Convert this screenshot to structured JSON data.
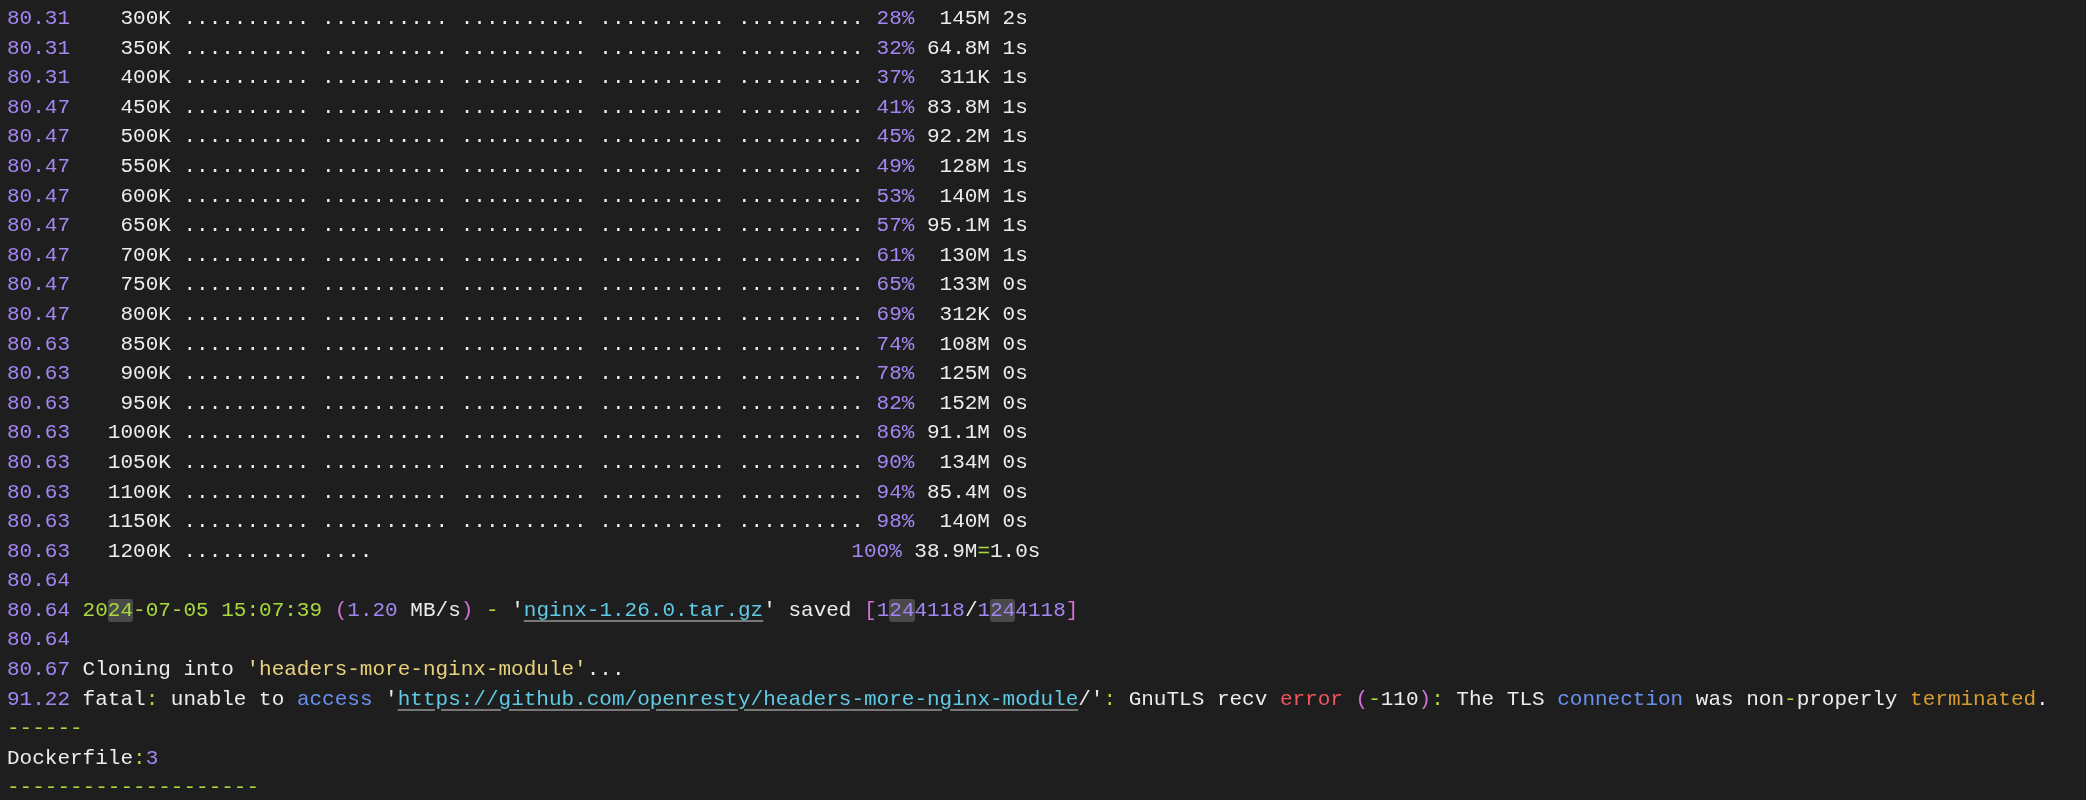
{
  "terminal": {
    "lines": [
      {
        "segments": [
          {
            "text": "80.31",
            "kind": "time"
          },
          {
            "text": "    300K .......... .......... .......... .......... .......... ",
            "kind": "plain"
          },
          {
            "text": "28%",
            "kind": "number"
          },
          {
            "text": "  145M 2s",
            "kind": "plain"
          }
        ]
      },
      {
        "segments": [
          {
            "text": "80.31",
            "kind": "time"
          },
          {
            "text": "    350K .......... .......... .......... .......... .......... ",
            "kind": "plain"
          },
          {
            "text": "32%",
            "kind": "number"
          },
          {
            "text": " 64.8M 1s",
            "kind": "plain"
          }
        ]
      },
      {
        "segments": [
          {
            "text": "80.31",
            "kind": "time"
          },
          {
            "text": "    400K .......... .......... .......... .......... .......... ",
            "kind": "plain"
          },
          {
            "text": "37%",
            "kind": "number"
          },
          {
            "text": "  311K 1s",
            "kind": "plain"
          }
        ]
      },
      {
        "segments": [
          {
            "text": "80.47",
            "kind": "time"
          },
          {
            "text": "    450K .......... .......... .......... .......... .......... ",
            "kind": "plain"
          },
          {
            "text": "41%",
            "kind": "number"
          },
          {
            "text": " 83.8M 1s",
            "kind": "plain"
          }
        ]
      },
      {
        "segments": [
          {
            "text": "80.47",
            "kind": "time"
          },
          {
            "text": "    500K .......... .......... .......... .......... .......... ",
            "kind": "plain"
          },
          {
            "text": "45%",
            "kind": "number"
          },
          {
            "text": " 92.2M 1s",
            "kind": "plain"
          }
        ]
      },
      {
        "segments": [
          {
            "text": "80.47",
            "kind": "time"
          },
          {
            "text": "    550K .......... .......... .......... .......... .......... ",
            "kind": "plain"
          },
          {
            "text": "49%",
            "kind": "number"
          },
          {
            "text": "  128M 1s",
            "kind": "plain"
          }
        ]
      },
      {
        "segments": [
          {
            "text": "80.47",
            "kind": "time"
          },
          {
            "text": "    600K .......... .......... .......... .......... .......... ",
            "kind": "plain"
          },
          {
            "text": "53%",
            "kind": "number"
          },
          {
            "text": "  140M 1s",
            "kind": "plain"
          }
        ]
      },
      {
        "segments": [
          {
            "text": "80.47",
            "kind": "time"
          },
          {
            "text": "    650K .......... .......... .......... .......... .......... ",
            "kind": "plain"
          },
          {
            "text": "57%",
            "kind": "number"
          },
          {
            "text": " 95.1M 1s",
            "kind": "plain"
          }
        ]
      },
      {
        "segments": [
          {
            "text": "80.47",
            "kind": "time"
          },
          {
            "text": "    700K .......... .......... .......... .......... .......... ",
            "kind": "plain"
          },
          {
            "text": "61%",
            "kind": "number"
          },
          {
            "text": "  130M 1s",
            "kind": "plain"
          }
        ]
      },
      {
        "segments": [
          {
            "text": "80.47",
            "kind": "time"
          },
          {
            "text": "    750K .......... .......... .......... .......... .......... ",
            "kind": "plain"
          },
          {
            "text": "65%",
            "kind": "number"
          },
          {
            "text": "  133M 0s",
            "kind": "plain"
          }
        ]
      },
      {
        "segments": [
          {
            "text": "80.47",
            "kind": "time"
          },
          {
            "text": "    800K .......... .......... .......... .......... .......... ",
            "kind": "plain"
          },
          {
            "text": "69%",
            "kind": "number"
          },
          {
            "text": "  312K 0s",
            "kind": "plain"
          }
        ]
      },
      {
        "segments": [
          {
            "text": "80.63",
            "kind": "time"
          },
          {
            "text": "    850K .......... .......... .......... .......... .......... ",
            "kind": "plain"
          },
          {
            "text": "74%",
            "kind": "number"
          },
          {
            "text": "  108M 0s",
            "kind": "plain"
          }
        ]
      },
      {
        "segments": [
          {
            "text": "80.63",
            "kind": "time"
          },
          {
            "text": "    900K .......... .......... .......... .......... .......... ",
            "kind": "plain"
          },
          {
            "text": "78%",
            "kind": "number"
          },
          {
            "text": "  125M 0s",
            "kind": "plain"
          }
        ]
      },
      {
        "segments": [
          {
            "text": "80.63",
            "kind": "time"
          },
          {
            "text": "    950K .......... .......... .......... .......... .......... ",
            "kind": "plain"
          },
          {
            "text": "82%",
            "kind": "number"
          },
          {
            "text": "  152M 0s",
            "kind": "plain"
          }
        ]
      },
      {
        "segments": [
          {
            "text": "80.63",
            "kind": "time"
          },
          {
            "text": "   1000K .......... .......... .......... .......... .......... ",
            "kind": "plain"
          },
          {
            "text": "86%",
            "kind": "number"
          },
          {
            "text": " 91.1M 0s",
            "kind": "plain"
          }
        ]
      },
      {
        "segments": [
          {
            "text": "80.63",
            "kind": "time"
          },
          {
            "text": "   1050K .......... .......... .......... .......... .......... ",
            "kind": "plain"
          },
          {
            "text": "90%",
            "kind": "number"
          },
          {
            "text": "  134M 0s",
            "kind": "plain"
          }
        ]
      },
      {
        "segments": [
          {
            "text": "80.63",
            "kind": "time"
          },
          {
            "text": "   1100K .......... .......... .......... .......... .......... ",
            "kind": "plain"
          },
          {
            "text": "94%",
            "kind": "number"
          },
          {
            "text": " 85.4M 0s",
            "kind": "plain"
          }
        ]
      },
      {
        "segments": [
          {
            "text": "80.63",
            "kind": "time"
          },
          {
            "text": "   1150K .......... .......... .......... .......... .......... ",
            "kind": "plain"
          },
          {
            "text": "98%",
            "kind": "number"
          },
          {
            "text": "  140M 0s",
            "kind": "plain"
          }
        ]
      },
      {
        "segments": [
          {
            "text": "80.63",
            "kind": "time"
          },
          {
            "text": "   1200K .......... ....                                      ",
            "kind": "plain"
          },
          {
            "text": "100%",
            "kind": "number"
          },
          {
            "text": " 38.9M",
            "kind": "plain"
          },
          {
            "text": "=",
            "kind": "punct"
          },
          {
            "text": "1.0s",
            "kind": "plain"
          }
        ]
      },
      {
        "segments": [
          {
            "text": "80.64",
            "kind": "time"
          }
        ]
      },
      {
        "segments": [
          {
            "text": "80.64",
            "kind": "time"
          },
          {
            "text": " 20",
            "kind": "date"
          },
          {
            "text": "24",
            "kind": "date-match"
          },
          {
            "text": "-07-05 15:07:39 ",
            "kind": "date"
          },
          {
            "text": "(",
            "kind": "paren"
          },
          {
            "text": "1.20",
            "kind": "number"
          },
          {
            "text": " MB/s",
            "kind": "plain"
          },
          {
            "text": ")",
            "kind": "paren"
          },
          {
            "text": " -",
            "kind": "punct"
          },
          {
            "text": " '",
            "kind": "plain"
          },
          {
            "text": "nginx-1.26.0.tar.gz",
            "kind": "link"
          },
          {
            "text": "' saved ",
            "kind": "plain"
          },
          {
            "text": "[",
            "kind": "paren"
          },
          {
            "text": "1",
            "kind": "number"
          },
          {
            "text": "24",
            "kind": "number-match"
          },
          {
            "text": "4118",
            "kind": "number"
          },
          {
            "text": "/",
            "kind": "plain"
          },
          {
            "text": "1",
            "kind": "number"
          },
          {
            "text": "24",
            "kind": "number-match"
          },
          {
            "text": "4118",
            "kind": "number"
          },
          {
            "text": "]",
            "kind": "paren"
          }
        ]
      },
      {
        "segments": [
          {
            "text": "80.64",
            "kind": "time"
          }
        ]
      },
      {
        "segments": [
          {
            "text": "80.67",
            "kind": "time"
          },
          {
            "text": " Cloning into ",
            "kind": "plain"
          },
          {
            "text": "'headers-more-nginx-module'",
            "kind": "string"
          },
          {
            "text": "...",
            "kind": "plain"
          }
        ]
      },
      {
        "segments": [
          {
            "text": "91.22",
            "kind": "time"
          },
          {
            "text": " fatal",
            "kind": "plain"
          },
          {
            "text": ":",
            "kind": "punct"
          },
          {
            "text": " unable to ",
            "kind": "plain"
          },
          {
            "text": "access",
            "kind": "keyword"
          },
          {
            "text": " '",
            "kind": "plain"
          },
          {
            "text": "https://github.com/openresty/headers-more-nginx-module",
            "kind": "link"
          },
          {
            "text": "/'",
            "kind": "plain"
          },
          {
            "text": ":",
            "kind": "punct"
          },
          {
            "text": " GnuTLS recv ",
            "kind": "plain"
          },
          {
            "text": "error",
            "kind": "error"
          },
          {
            "text": " (",
            "kind": "paren"
          },
          {
            "text": "-",
            "kind": "punct"
          },
          {
            "text": "110",
            "kind": "plain"
          },
          {
            "text": ")",
            "kind": "paren"
          },
          {
            "text": ":",
            "kind": "punct"
          },
          {
            "text": " The TLS ",
            "kind": "plain"
          },
          {
            "text": "connection",
            "kind": "keyword"
          },
          {
            "text": " was non",
            "kind": "plain"
          },
          {
            "text": "-",
            "kind": "punct"
          },
          {
            "text": "properly ",
            "kind": "plain"
          },
          {
            "text": "terminated",
            "kind": "warning"
          },
          {
            "text": ".",
            "kind": "plain"
          }
        ]
      },
      {
        "segments": [
          {
            "text": "------",
            "kind": "punct"
          }
        ]
      },
      {
        "segments": [
          {
            "text": "Dockerfile",
            "kind": "plain"
          },
          {
            "text": ":",
            "kind": "punct"
          },
          {
            "text": "3",
            "kind": "number"
          }
        ]
      },
      {
        "segments": [
          {
            "text": "--------------------",
            "kind": "punct"
          }
        ]
      }
    ]
  }
}
